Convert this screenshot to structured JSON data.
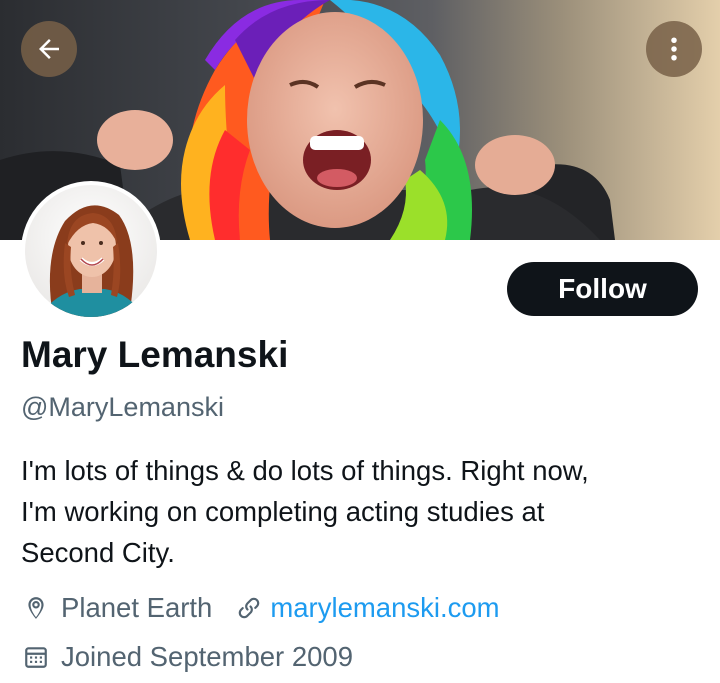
{
  "profile": {
    "name": "Mary Lemanski",
    "handle": "@MaryLemanski",
    "bio_lines": [
      "I'm lots of things & do lots of things. Right now,",
      "I'm working on completing acting studies at",
      "Second City."
    ],
    "location": "Planet Earth",
    "website": "marylemanski.com",
    "joined": "Joined September 2009"
  },
  "actions": {
    "follow_label": "Follow"
  },
  "icons": {
    "back": "arrow-left-icon",
    "more": "more-vertical-icon",
    "location": "map-pin-icon",
    "link": "link-icon",
    "calendar": "calendar-icon"
  },
  "colors": {
    "accent": "#1d9bf0",
    "text_primary": "#0f1419",
    "text_secondary": "#536471",
    "follow_button": "#0f1419"
  }
}
